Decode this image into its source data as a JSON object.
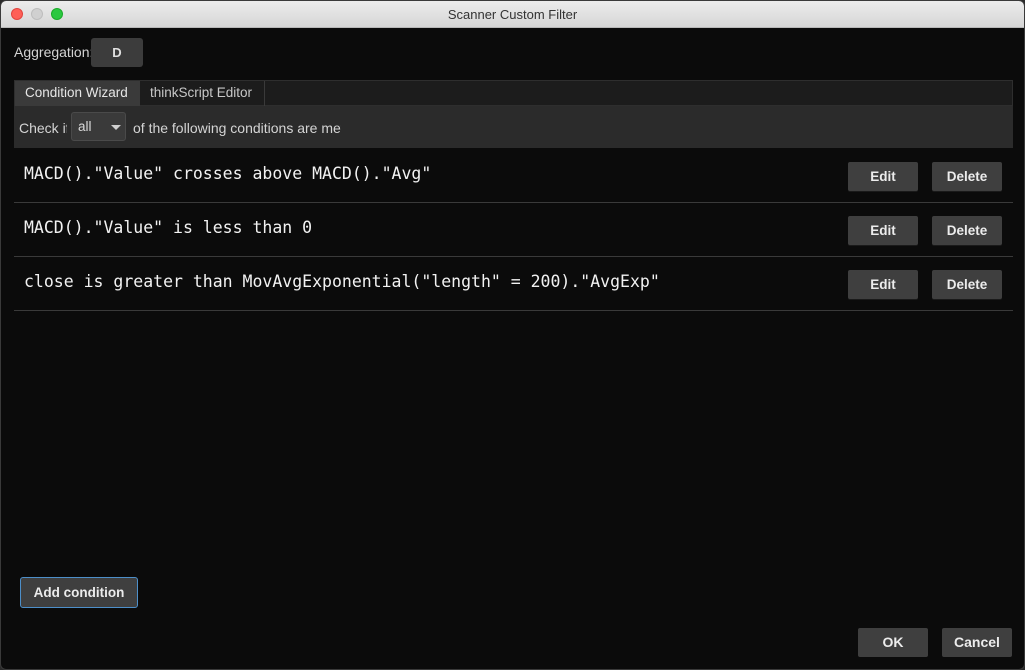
{
  "window": {
    "title": "Scanner Custom Filter"
  },
  "aggregation": {
    "label": "Aggregation:",
    "value": "D"
  },
  "tabs": [
    {
      "label": "Condition Wizard",
      "active": true
    },
    {
      "label": "thinkScript Editor",
      "active": false
    }
  ],
  "check_bar": {
    "prefix": "Check if",
    "selected": "all",
    "suffix": "of the following conditions are met"
  },
  "conditions": [
    {
      "text": "MACD().\"Value\" crosses above MACD().\"Avg\"",
      "edit_label": "Edit",
      "delete_label": "Delete"
    },
    {
      "text": "MACD().\"Value\" is less than 0",
      "edit_label": "Edit",
      "delete_label": "Delete"
    },
    {
      "text": "close is greater than MovAvgExponential(\"length\" = 200).\"AvgExp\"",
      "edit_label": "Edit",
      "delete_label": "Delete"
    }
  ],
  "footer": {
    "add_condition_label": "Add condition",
    "ok_label": "OK",
    "cancel_label": "Cancel"
  }
}
